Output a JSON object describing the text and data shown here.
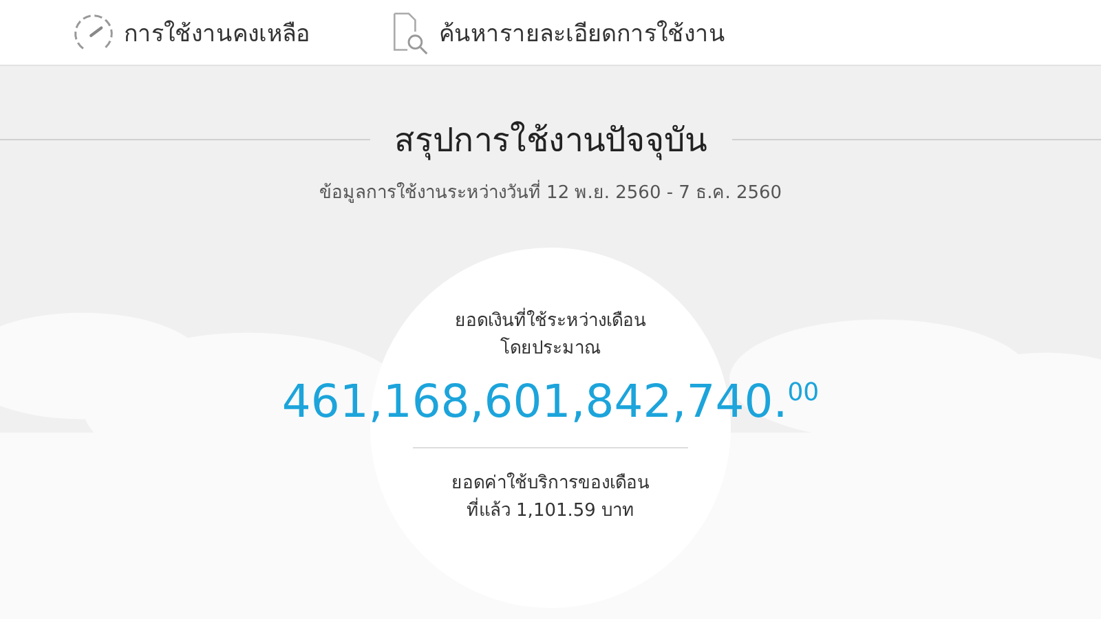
{
  "nav": [
    {
      "kind": "gauge",
      "label": "การใช้งานคงเหลือ"
    },
    {
      "kind": "search",
      "label": "ค้นหารายละเอียดการใช้งาน"
    }
  ],
  "summary": {
    "title": "สรุปการใช้งานปัจจุบัน",
    "subtitle": "ข้อมูลการใช้งานระหว่างวันที่ 12 พ.ย. 2560 - 7 ธ.ค. 2560",
    "current_label": "ยอดเงินที่ใช้ระหว่างเดือน\nโดยประมาณ",
    "current_amount": "461,168,601,842,740.$^{00}$",
    "previous_label": "ยอดค่าใช้บริการของเดือน\nที่แล้ว 1,101.59 บาท"
  }
}
